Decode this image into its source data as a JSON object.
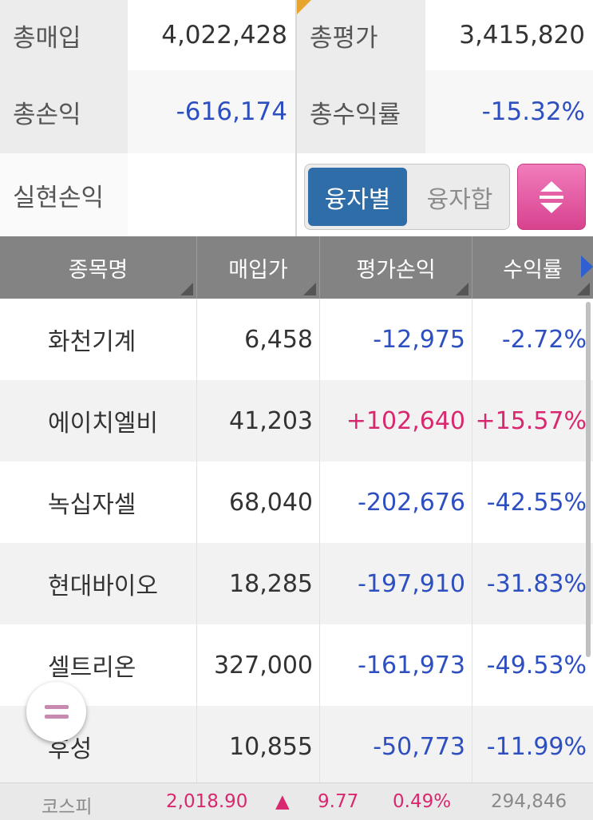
{
  "summary": {
    "total_purchase_label": "총매입",
    "total_purchase_value": "4,022,428",
    "total_eval_label": "총평가",
    "total_eval_value": "3,415,820",
    "total_pl_label": "총손익",
    "total_pl_value": "-616,174",
    "total_return_label": "총수익률",
    "total_return_value": "-15.32%",
    "realized_pl_label": "실현손익",
    "realized_pl_value": "",
    "toggle": {
      "by_loan": "융자별",
      "loan_sum": "융자합",
      "selected": "융자별"
    }
  },
  "table": {
    "headers": [
      "종목명",
      "매입가",
      "평가손익",
      "수익률"
    ],
    "rows": [
      {
        "name": "화천기계",
        "price": "6,458",
        "pl": "-12,975",
        "rate": "-2.72%"
      },
      {
        "name": "에이치엘비",
        "price": "41,203",
        "pl": "+102,640",
        "rate": "+15.57%"
      },
      {
        "name": "녹십자셀",
        "price": "68,040",
        "pl": "-202,676",
        "rate": "-42.55%"
      },
      {
        "name": "현대바이오",
        "price": "18,285",
        "pl": "-197,910",
        "rate": "-31.83%"
      },
      {
        "name": "셀트리온",
        "price": "327,000",
        "pl": "-161,973",
        "rate": "-49.53%"
      },
      {
        "name": "후성",
        "price": "10,855",
        "pl": "-50,773",
        "rate": "-11.99%"
      }
    ]
  },
  "ticker": {
    "index_name": "코스피",
    "index_value": "2,018.90",
    "change_symbol": "▲",
    "change": "9.77",
    "change_pct": "0.49%",
    "volume": "294,846"
  },
  "icons": {
    "sort": "up-down-arrows-icon",
    "menu": "menu-lines-icon",
    "next_column": "right-triangle-icon"
  },
  "colors": {
    "negative": "#2d4fc0",
    "positive": "#d8286f",
    "header_bg": "#838383",
    "toggle_selected": "#2f6da8",
    "sort_button": "#e0559f"
  }
}
